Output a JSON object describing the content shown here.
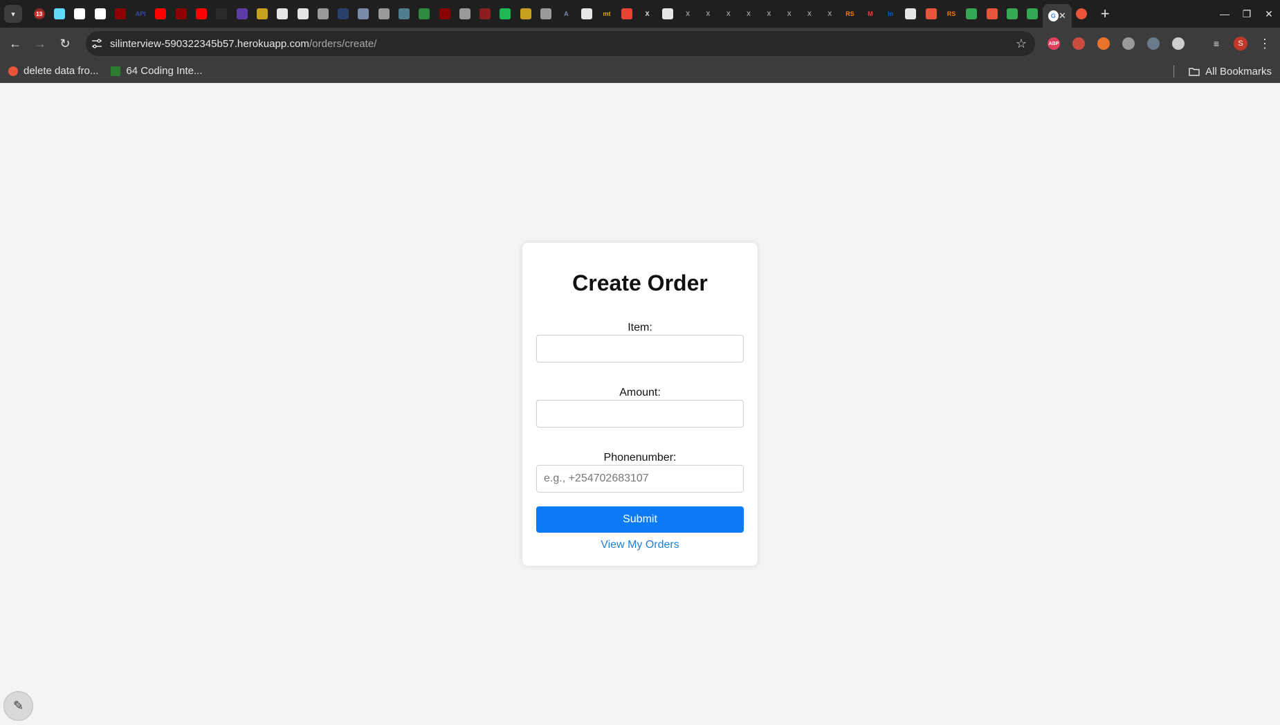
{
  "browser": {
    "active_tab_close": "✕",
    "new_tab": "+",
    "window_controls": [
      "—",
      "❐",
      "✕"
    ],
    "url_host": "silinterview-590322345b57.herokuapp.com",
    "url_path": "/orders/create/",
    "profile_initial": "S",
    "tab_count_badge": "13",
    "bookmarks": [
      {
        "label": "delete data fro...",
        "icon_color": "#e8553a"
      },
      {
        "label": "64 Coding Inte...",
        "icon_color": "#2e7d32"
      }
    ],
    "all_bookmarks": "All Bookmarks",
    "tab_favicons": [
      {
        "color": "#8f2a2a"
      },
      {
        "color": "#61dafb"
      },
      {
        "color": "#ffffff"
      },
      {
        "color": "#ffffff"
      },
      {
        "color": "#8b0000"
      },
      {
        "color": "#2f4a9e",
        "text": "API"
      },
      {
        "color": "#ff0000"
      },
      {
        "color": "#8b0000"
      },
      {
        "color": "#ff0000"
      },
      {
        "color": "#2a2a2a"
      },
      {
        "color": "#5c3da8"
      },
      {
        "color": "#c8a020"
      },
      {
        "color": "#e6e6e6"
      },
      {
        "color": "#e6e6e6"
      },
      {
        "color": "#9a9a9a"
      },
      {
        "color": "#29406b"
      },
      {
        "color": "#7a8ba8"
      },
      {
        "color": "#9a9a9a"
      },
      {
        "color": "#4f7e8f"
      },
      {
        "color": "#2e8b3e"
      },
      {
        "color": "#8b0000"
      },
      {
        "color": "#9a9a9a"
      },
      {
        "color": "#8b1f1f"
      },
      {
        "color": "#1db954"
      },
      {
        "color": "#c8a020"
      },
      {
        "color": "#9a9a9a"
      },
      {
        "color": "#7a8ba8",
        "text": "A"
      },
      {
        "color": "#e6e6e6"
      },
      {
        "color": "#d9a520",
        "text": "mt"
      },
      {
        "color": "#ea4335"
      },
      {
        "color": "#e6e6e6",
        "text": "X"
      },
      {
        "color": "#e6e6e6"
      },
      {
        "color": "#9a9a9a",
        "text": "X"
      },
      {
        "color": "#9a9a9a",
        "text": "X"
      },
      {
        "color": "#9a9a9a",
        "text": "X"
      },
      {
        "color": "#9a9a9a",
        "text": "X"
      },
      {
        "color": "#9a9a9a",
        "text": "X"
      },
      {
        "color": "#9a9a9a",
        "text": "X"
      },
      {
        "color": "#9a9a9a",
        "text": "X"
      },
      {
        "color": "#9a9a9a",
        "text": "X"
      },
      {
        "color": "#f57c00",
        "text": "RS"
      },
      {
        "color": "#ea4335",
        "text": "M"
      },
      {
        "color": "#0a66c2",
        "text": "in"
      },
      {
        "color": "#e6e6e6"
      },
      {
        "color": "#e8553a"
      },
      {
        "color": "#f57c00",
        "text": "RS"
      },
      {
        "color": "#34a853"
      },
      {
        "color": "#e8553a"
      },
      {
        "color": "#34a853"
      },
      {
        "color": "#34a853"
      }
    ],
    "extensions": [
      {
        "color": "#e0405e",
        "text": "ABP"
      },
      {
        "color": "#c94c3f",
        "text": ""
      },
      {
        "color": "#e8742a",
        "text": ""
      },
      {
        "color": "#9a9a9a",
        "text": ""
      },
      {
        "color": "#6a7a8c",
        "text": ""
      },
      {
        "color": "#cfcfcf",
        "text": ""
      }
    ]
  },
  "form": {
    "title": "Create Order",
    "item_label": "Item:",
    "item_value": "",
    "amount_label": "Amount:",
    "amount_value": "",
    "phone_label": "Phonenumber:",
    "phone_placeholder": "e.g., +254702683107",
    "submit_label": "Submit",
    "view_orders_link": "View My Orders"
  }
}
